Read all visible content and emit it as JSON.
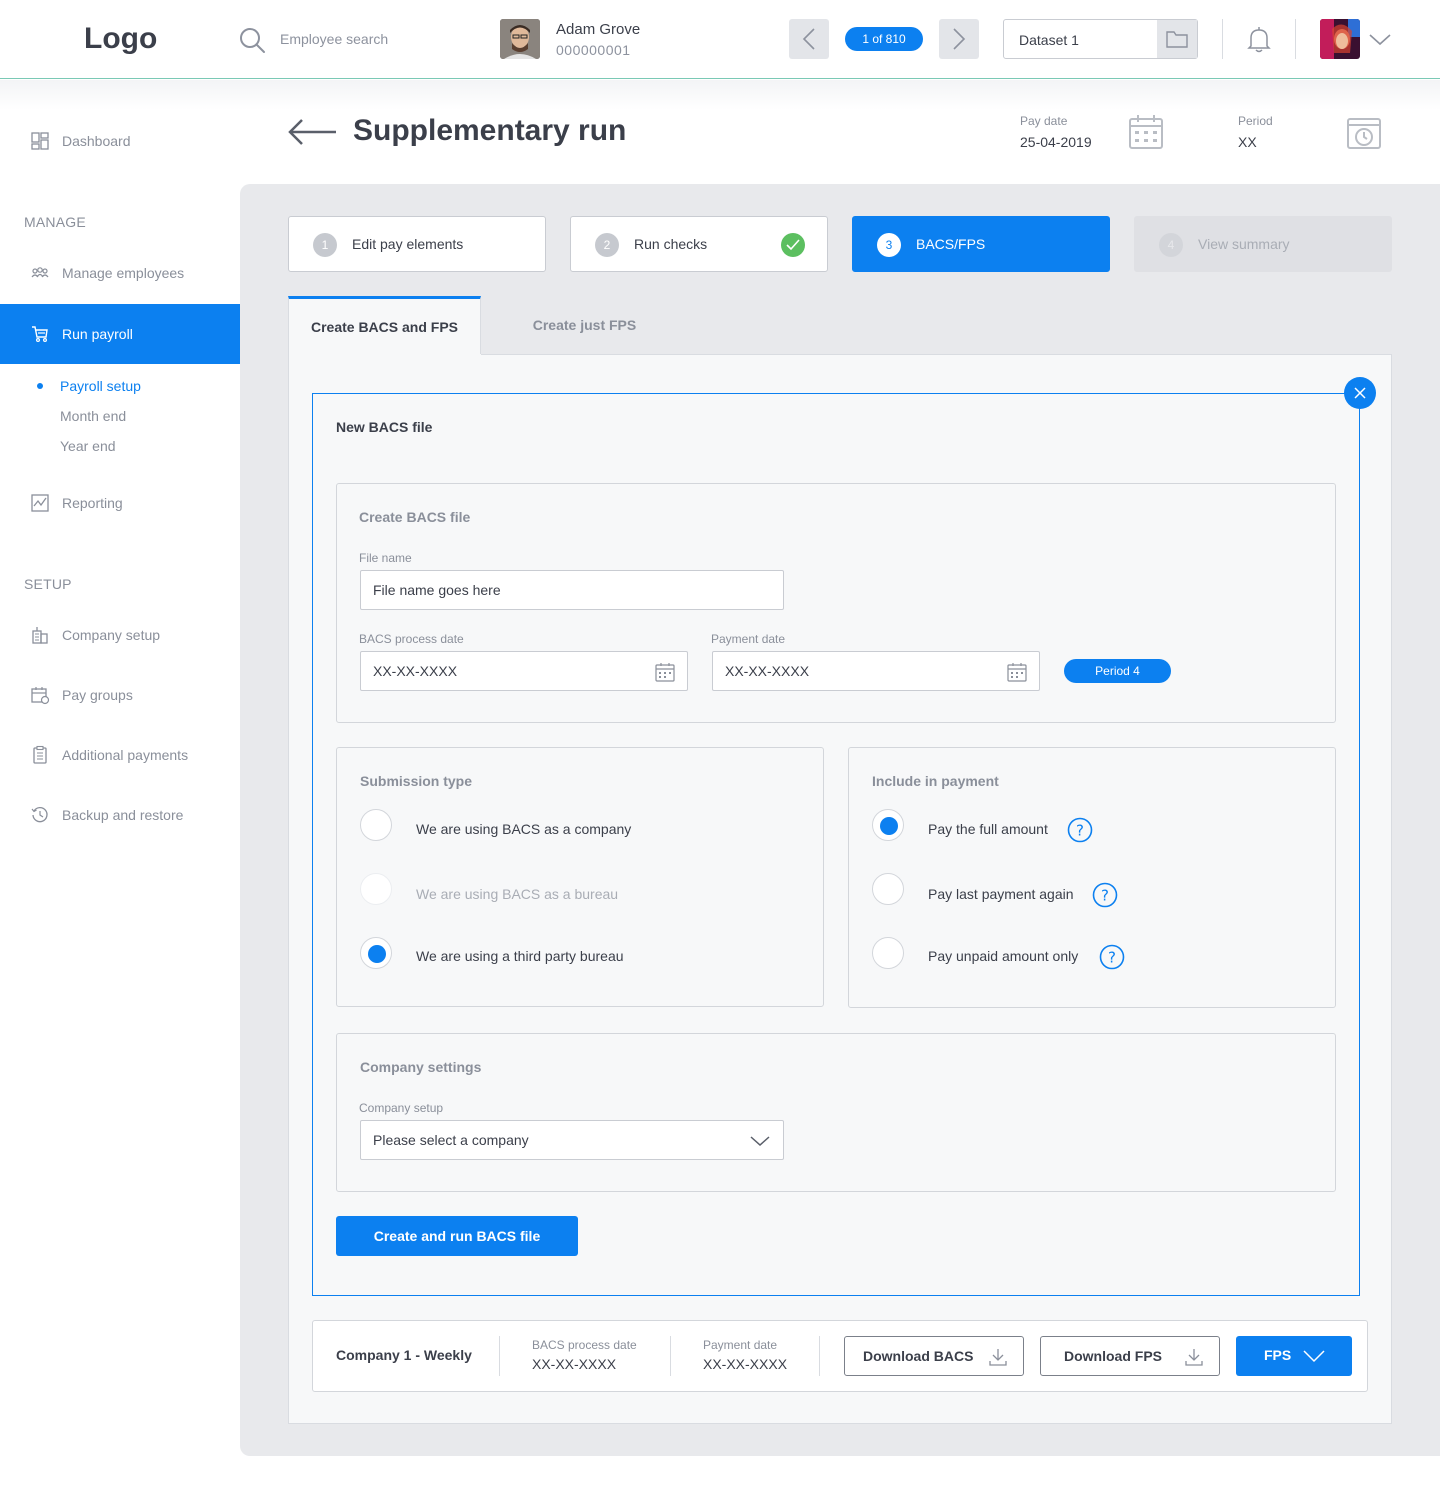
{
  "header": {
    "logo": "Logo",
    "search_placeholder": "Employee search",
    "employee": {
      "name": "Adam Grove",
      "id": "000000001"
    },
    "pager": "1 of 810",
    "dataset": "Dataset 1"
  },
  "sidebar": {
    "dashboard": "Dashboard",
    "manage_heading": "MANAGE",
    "manage_employees": "Manage employees",
    "run_payroll": "Run payroll",
    "sub_items": [
      "Payroll setup",
      "Month end",
      "Year end"
    ],
    "reporting": "Reporting",
    "setup_heading": "SETUP",
    "company_setup": "Company setup",
    "pay_groups": "Pay groups",
    "additional_payments": "Additional payments",
    "backup_restore": "Backup and restore"
  },
  "page": {
    "title": "Supplementary run",
    "pay_date_label": "Pay date",
    "pay_date": "25-04-2019",
    "period_label": "Period",
    "period": "XX"
  },
  "steps": [
    {
      "num": "1",
      "label": "Edit pay elements"
    },
    {
      "num": "2",
      "label": "Run checks"
    },
    {
      "num": "3",
      "label": "BACS/FPS"
    },
    {
      "num": "4",
      "label": "View summary"
    }
  ],
  "tabs": {
    "active": "Create BACS and FPS",
    "inactive": "Create just FPS"
  },
  "bacs": {
    "title": "New BACS file",
    "create_section": {
      "title": "Create BACS file",
      "file_name_label": "File name",
      "file_name_value": "File name goes here",
      "process_date_label": "BACS process date",
      "process_date_value": "XX-XX-XXXX",
      "payment_date_label": "Payment date",
      "payment_date_value": "XX-XX-XXXX",
      "period_badge": "Period 4"
    },
    "submission": {
      "title": "Submission type",
      "options": [
        "We are using BACS as a company",
        "We are using BACS as a bureau",
        "We are using a third party bureau"
      ]
    },
    "include": {
      "title": "Include in payment",
      "options": [
        "Pay the full amount",
        "Pay last payment again",
        "Pay unpaid amount only"
      ]
    },
    "company": {
      "title": "Company settings",
      "label": "Company setup",
      "value": "Please select a company"
    },
    "submit": "Create and run BACS file"
  },
  "summary": {
    "company": "Company 1 - Weekly",
    "process_date_label": "BACS process date",
    "process_date_value": "XX-XX-XXXX",
    "payment_date_label": "Payment date",
    "payment_date_value": "XX-XX-XXXX",
    "download_bacs": "Download BACS",
    "download_fps": "Download FPS",
    "fps": "FPS"
  },
  "colors": {
    "accent": "#0c80f0",
    "success": "#5cbf60",
    "panel": "#e8e9ec"
  },
  "icons": [
    "search-icon",
    "chevron-left-icon",
    "chevron-right-icon",
    "folder-icon",
    "bell-icon",
    "chevron-down-icon",
    "dashboard-icon",
    "people-icon",
    "cart-icon",
    "chart-icon",
    "building-icon",
    "calendar-star-icon",
    "clipboard-icon",
    "history-icon",
    "arrow-left-icon",
    "calendar-icon",
    "stopwatch-icon",
    "check-icon",
    "close-icon",
    "help-icon",
    "download-icon"
  ]
}
